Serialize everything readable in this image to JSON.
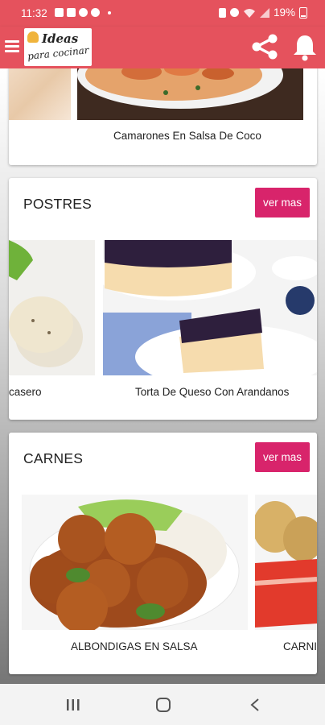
{
  "status_bar": {
    "time": "11:32",
    "battery": "19%",
    "icons": [
      "gallery-icon",
      "mail-icon",
      "face-icon",
      "shield-icon",
      "vibrate-icon",
      "alarm-icon",
      "wifi-icon",
      "signal-icon",
      "battery-icon"
    ]
  },
  "toolbar": {
    "menu_icon": "hamburger-icon",
    "logo_line1": "Ideas",
    "logo_line2": "para cocinar",
    "share_icon": "share-icon",
    "bell_icon": "bell-icon"
  },
  "sections": [
    {
      "title": "",
      "items": [
        {
          "caption": "Camarones En Salsa De Coco"
        }
      ]
    },
    {
      "title": "POSTRES",
      "button": "ver mas",
      "items": [
        {
          "caption": "casero"
        },
        {
          "caption": "Torta De Queso Con Arandanos"
        }
      ]
    },
    {
      "title": "CARNES",
      "button": "ver mas",
      "items": [
        {
          "caption": "ALBONDIGAS EN SALSA"
        },
        {
          "caption": "CARNI"
        }
      ]
    }
  ],
  "nav_bar": {
    "icons": [
      "recent-apps-icon",
      "home-icon",
      "back-icon"
    ]
  },
  "colors": {
    "primary": "#e5525d",
    "accent": "#d8246b"
  }
}
